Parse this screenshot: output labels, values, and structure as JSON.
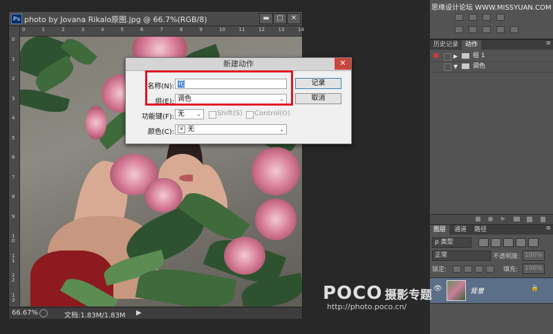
{
  "document": {
    "title": "photo by Jovana Rikalo原图.jpg @ 66.7%(RGB/8)",
    "app_badge": "Ps",
    "minimize_glyph": "▬",
    "restore_glyph": "□",
    "close_glyph": "✕",
    "ruler_top": [
      "0",
      "1",
      "2",
      "3",
      "4",
      "5",
      "6",
      "7",
      "8",
      "9",
      "10",
      "11",
      "12",
      "13",
      "14"
    ],
    "ruler_left": [
      "0",
      "1",
      "2",
      "3",
      "4",
      "5",
      "6",
      "7",
      "8",
      "9",
      "10",
      "11",
      "12",
      "13"
    ],
    "zoom": "66.67%",
    "doc_size": "文档:1.83M/1.83M",
    "status_arrow": "▶"
  },
  "dialog": {
    "title": "新建动作",
    "close_glyph": "✕",
    "name_label": "名称(N):",
    "name_value": "花",
    "set_label": "组(E):",
    "set_value": "调色",
    "function_key_label": "功能键(F):",
    "function_key_value": "无",
    "shift_label": "Shift(S)",
    "control_label": "Control(O)",
    "color_label": "颜色(C):",
    "color_value": "无",
    "color_swatch_glyph": "✕",
    "record_button": "记录",
    "cancel_button": "取消",
    "arrow_glyph": "⌄"
  },
  "top_credit": "思缘设计论坛 WWW.MISSYUAN.COM",
  "actions_panel": {
    "tabs": [
      "历史记录",
      "动作"
    ],
    "active_tab": 1,
    "rows": [
      {
        "label": "组 1",
        "expanded": false
      },
      {
        "label": "调色",
        "expanded": true
      }
    ],
    "menu_glyph": "≡"
  },
  "layers_panel": {
    "tabs": [
      "图层",
      "通道",
      "路径"
    ],
    "active_tab": 0,
    "kind_filter": "ρ 类型",
    "blend_mode": "正常",
    "opacity_label": "不透明度:",
    "opacity_value": "100%",
    "lock_label": "锁定:",
    "fill_label": "填充:",
    "fill_value": "100%",
    "layer_name": "背景",
    "eye_glyph": "👁",
    "lock_glyph": "🔒",
    "menu_glyph": "≡"
  },
  "watermark": {
    "brand": "POCO",
    "subtitle": "摄影专题",
    "url": "http://photo.poco.cn/"
  },
  "colors": {
    "accent_red": "#e0121f",
    "panel_bg": "#535353",
    "selected_layer": "#5c6f88"
  }
}
